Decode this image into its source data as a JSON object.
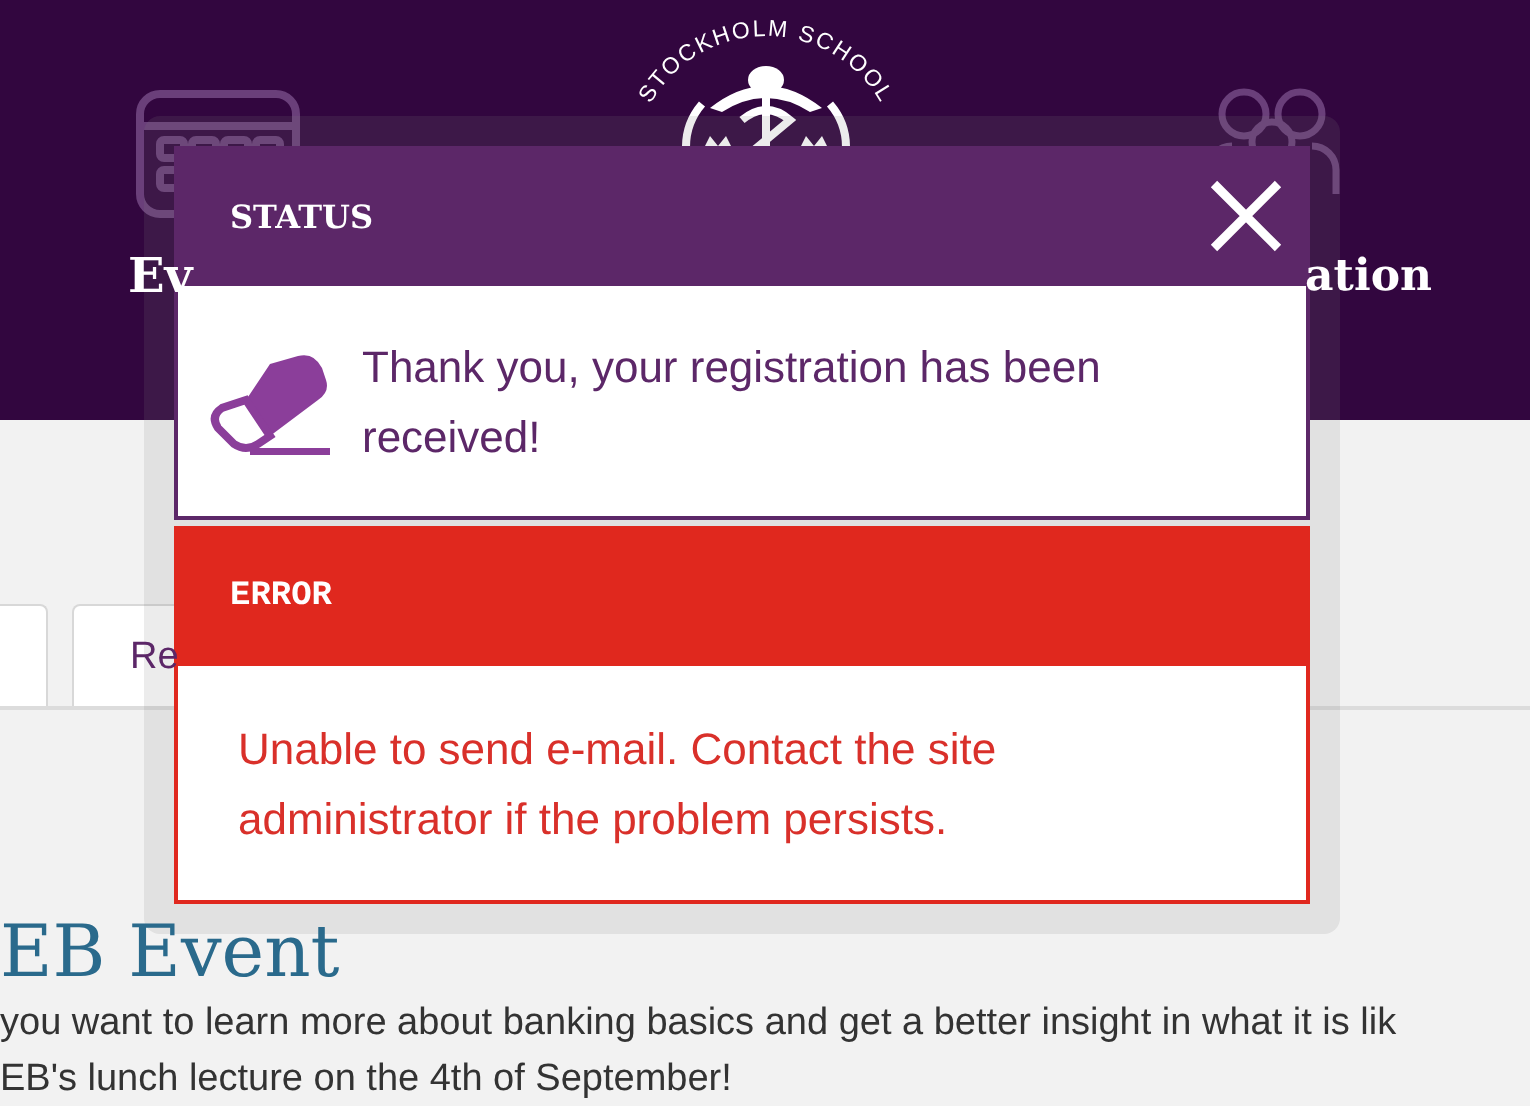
{
  "header": {
    "logo_text": "STOCKHOLM SCHOOL",
    "nav": [
      {
        "label": "Ev",
        "kind": "calendar"
      },
      {
        "label": "ation",
        "kind": "group"
      }
    ]
  },
  "tabs": [
    {
      "label": "Re"
    }
  ],
  "heading": "EB Event",
  "paragraph": [
    "you want to learn more about banking basics and get a better insight in what it is lik",
    "EB's lunch lecture on the 4th of September!"
  ],
  "messages": [
    {
      "kind": "status",
      "title": "STATUS",
      "text": "Thank you, your registration has been received!",
      "closable": true
    },
    {
      "kind": "error",
      "title": "ERROR",
      "text": "Unable to send e-mail. Contact the site administrator if the problem persists.",
      "closable": false
    }
  ]
}
